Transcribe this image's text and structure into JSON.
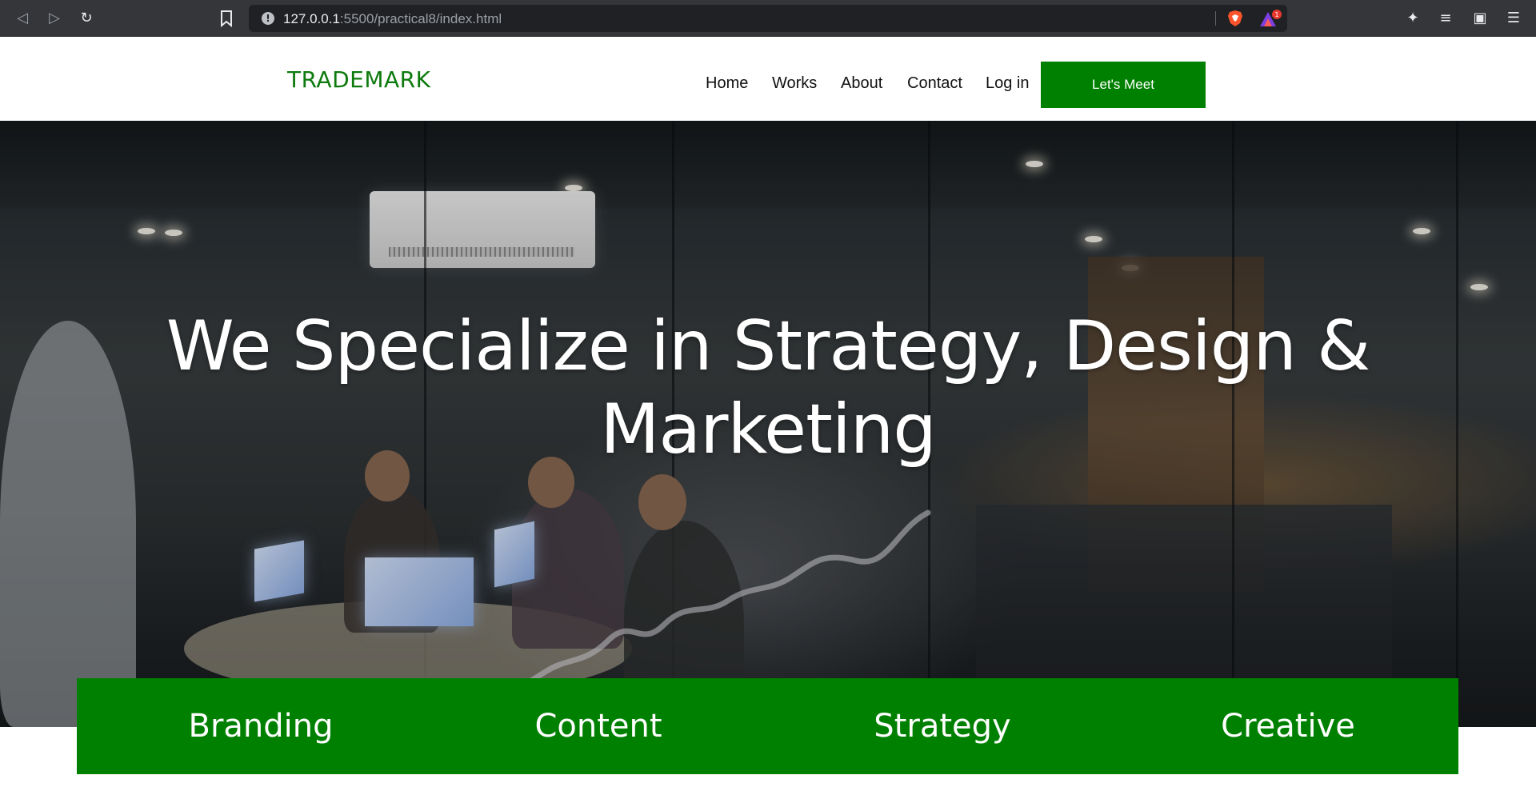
{
  "browser": {
    "url_host": "127.0.0.1",
    "url_rest": ":5500/practical8/index.html",
    "back_icon": "back-arrow-icon",
    "forward_icon": "forward-arrow-icon",
    "reload_icon": "reload-icon",
    "rewards_badge": "1"
  },
  "header": {
    "logo": "TRADEMARK",
    "nav": [
      "Home",
      "Works",
      "About",
      "Contact",
      "Log in"
    ],
    "cta": "Let's Meet",
    "accent_color": "#008000"
  },
  "hero": {
    "title_line1": "We Specialize in Strategy, Design &",
    "title_line2": "Marketing"
  },
  "services": [
    "Branding",
    "Content",
    "Strategy",
    "Creative"
  ]
}
